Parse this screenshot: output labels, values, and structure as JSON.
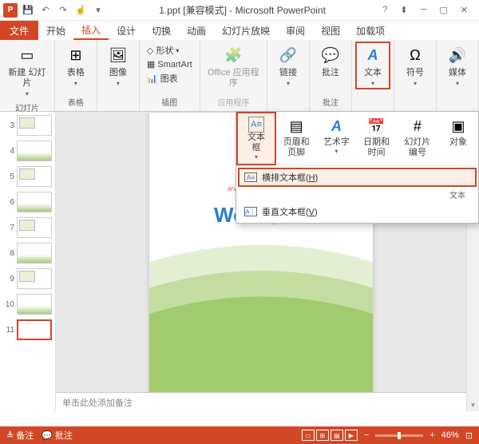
{
  "title": "1.ppt [兼容模式] - Microsoft PowerPoint",
  "tabs": {
    "file": "文件",
    "home": "开始",
    "insert": "插入",
    "design": "设计",
    "transition": "切换",
    "animation": "动画",
    "slideshow": "幻灯片放映",
    "review": "审阅",
    "view": "视图",
    "addin": "加载项"
  },
  "ribbon": {
    "newslide": "新建\n幻灯片",
    "slides_group": "幻灯片",
    "table": "表格",
    "table_group": "表格",
    "image": "图像",
    "shapes": "形状",
    "smartart": "SmartArt",
    "chart": "图表",
    "illust_group": "插图",
    "office": "Office\n应用程序",
    "office_group": "应用程序",
    "link": "链接",
    "comment": "批注",
    "comment_group": "批注",
    "text": "文本",
    "symbol": "符号",
    "media": "媒体"
  },
  "dropdown": {
    "textbox": "文本框",
    "headerfooter": "页眉和页脚",
    "wordart": "艺术字",
    "datetime": "日期和时间",
    "slidenum": "幻灯片\n编号",
    "object": "对象",
    "group_label": "文本",
    "horiz": "横排文本框(",
    "horiz_key": "H",
    "vert": "垂直文本框(",
    "vert_key": "V",
    "paren": ")"
  },
  "notes_placeholder": "单击此处添加备注",
  "logo": {
    "word": "Word",
    "lianmeng": "联盟",
    "url": "www.wordlm.com"
  },
  "slides": [
    3,
    4,
    5,
    6,
    7,
    8,
    9,
    10,
    11
  ],
  "status": {
    "notes": "备注",
    "comments": "批注",
    "zoom": "46%"
  }
}
